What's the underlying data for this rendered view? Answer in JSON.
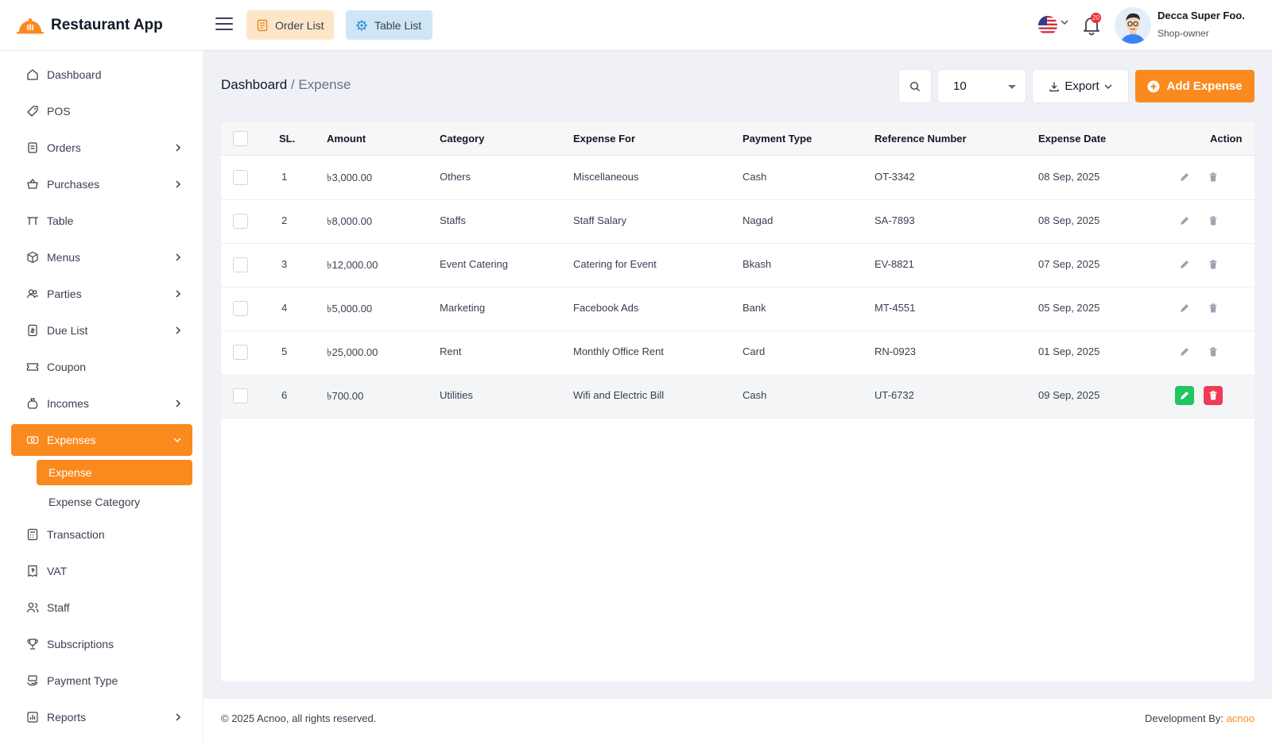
{
  "brand": {
    "name": "Restaurant App"
  },
  "header": {
    "order_list": "Order List",
    "table_list": "Table List",
    "notification_count": "20",
    "user_name": "Decca Super Foo.",
    "user_role": "Shop-owner"
  },
  "sidebar": {
    "items": [
      {
        "label": "Dashboard"
      },
      {
        "label": "POS"
      },
      {
        "label": "Orders"
      },
      {
        "label": "Purchases"
      },
      {
        "label": "Table"
      },
      {
        "label": "Menus"
      },
      {
        "label": "Parties"
      },
      {
        "label": "Due List"
      },
      {
        "label": "Coupon"
      },
      {
        "label": "Incomes"
      },
      {
        "label": "Expenses"
      },
      {
        "label": "Transaction"
      },
      {
        "label": "VAT"
      },
      {
        "label": "Staff"
      },
      {
        "label": "Subscriptions"
      },
      {
        "label": "Payment Type"
      },
      {
        "label": "Reports"
      }
    ],
    "sub_items": [
      {
        "label": "Expense"
      },
      {
        "label": "Expense Category"
      }
    ]
  },
  "breadcrumb": {
    "root": "Dashboard",
    "separator": " / ",
    "current": "Expense"
  },
  "toolbar": {
    "per_page": "10",
    "export_label": "Export",
    "add_label": "Add Expense"
  },
  "table": {
    "headers": [
      "SL.",
      "Amount",
      "Category",
      "Expense For",
      "Payment Type",
      "Reference Number",
      "Expense Date",
      "Action"
    ],
    "rows": [
      {
        "sl": "1",
        "amount": "৳3,000.00",
        "category": "Others",
        "expense_for": "Miscellaneous",
        "payment_type": "Cash",
        "reference": "OT-3342",
        "date": "08 Sep, 2025"
      },
      {
        "sl": "2",
        "amount": "৳8,000.00",
        "category": "Staffs",
        "expense_for": "Staff Salary",
        "payment_type": "Nagad",
        "reference": "SA-7893",
        "date": "08 Sep, 2025"
      },
      {
        "sl": "3",
        "amount": "৳12,000.00",
        "category": "Event Catering",
        "expense_for": "Catering for Event",
        "payment_type": "Bkash",
        "reference": "EV-8821",
        "date": "07 Sep, 2025"
      },
      {
        "sl": "4",
        "amount": "৳5,000.00",
        "category": "Marketing",
        "expense_for": "Facebook Ads",
        "payment_type": "Bank",
        "reference": "MT-4551",
        "date": "05 Sep, 2025"
      },
      {
        "sl": "5",
        "amount": "৳25,000.00",
        "category": "Rent",
        "expense_for": "Monthly Office Rent",
        "payment_type": "Card",
        "reference": "RN-0923",
        "date": "01 Sep, 2025"
      },
      {
        "sl": "6",
        "amount": "৳700.00",
        "category": "Utilities",
        "expense_for": "Wifi and Electric Bill",
        "payment_type": "Cash",
        "reference": "UT-6732",
        "date": "09 Sep, 2025"
      }
    ]
  },
  "footer": {
    "copyright": "© 2025 Acnoo, all rights reserved.",
    "dev_label": "Development By: ",
    "dev_link": "acnoo"
  },
  "colors": {
    "accent": "#fb8a1e",
    "edit": "#22c55e",
    "delete": "#ef3b57"
  }
}
